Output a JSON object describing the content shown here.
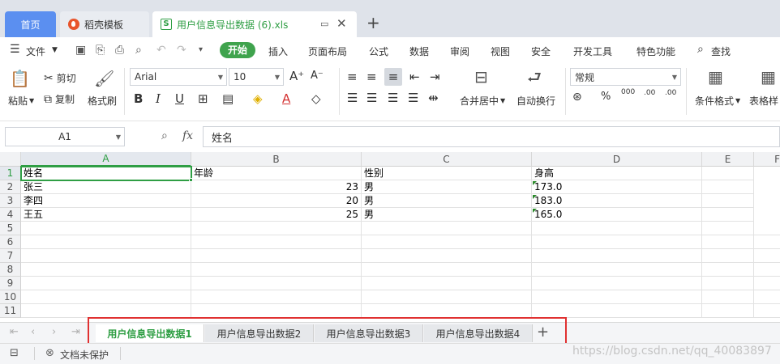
{
  "tabs": {
    "home": "首页",
    "template": "稻壳模板",
    "file": "用户信息导出数据 (6).xls"
  },
  "menu": {
    "file": "文件",
    "start": "开始",
    "insert": "插入",
    "layout": "页面布局",
    "formula": "公式",
    "data": "数据",
    "review": "审阅",
    "view": "视图",
    "security": "安全",
    "dev": "开发工具",
    "special": "特色功能",
    "search": "查找"
  },
  "ribbon": {
    "paste": "粘贴",
    "cut": "剪切",
    "copy": "复制",
    "format_painter": "格式刷",
    "font": "Arial",
    "size": "10",
    "merge_center": "合并居中",
    "wrap_text": "自动换行",
    "number_format": "常规",
    "conditional_format": "条件格式",
    "table_style": "表格样"
  },
  "formula_bar": {
    "cell_ref": "A1",
    "fx": "fx",
    "value": "姓名"
  },
  "columns": [
    "A",
    "B",
    "C",
    "D",
    "E",
    "F"
  ],
  "rows": [
    "1",
    "2",
    "3",
    "4",
    "5",
    "6",
    "7",
    "8",
    "9",
    "10",
    "11"
  ],
  "table": {
    "headers": [
      "姓名",
      "年龄",
      "性别",
      "身高"
    ],
    "records": [
      {
        "name": "张三",
        "age": "23",
        "gender": "男",
        "height": "173.0"
      },
      {
        "name": "李四",
        "age": "20",
        "gender": "男",
        "height": "183.0"
      },
      {
        "name": "王五",
        "age": "25",
        "gender": "男",
        "height": "165.0"
      }
    ]
  },
  "sheets": [
    "用户信息导出数据1",
    "用户信息导出数据2",
    "用户信息导出数据3",
    "用户信息导出数据4"
  ],
  "status": {
    "protect": "文档未保护"
  },
  "watermark": "https://blog.csdn.net/qq_40083897",
  "colors": {
    "accent_green": "#3fa34d",
    "selection_border": "#2f9e44",
    "annotation_red": "#e03131",
    "home_tab_blue": "#5b8ff0"
  }
}
